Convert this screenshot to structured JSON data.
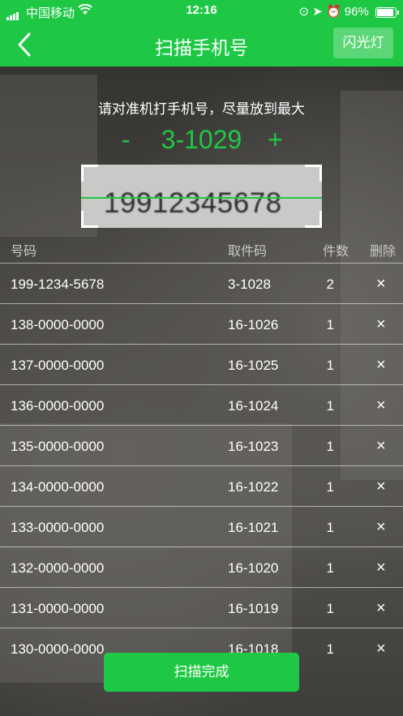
{
  "status_bar": {
    "carrier": "中国移动",
    "time": "12:16",
    "battery": "96%"
  },
  "nav": {
    "title": "扫描手机号",
    "flash_label": "闪光灯"
  },
  "hint": "请对准机打手机号，尽量放到最大",
  "counter": {
    "minus": "-",
    "value": "3-1029",
    "plus": "+"
  },
  "scan_preview_text": "19912345678",
  "table": {
    "headers": {
      "phone": "号码",
      "code": "取件码",
      "count": "件数",
      "delete": "删除"
    },
    "rows": [
      {
        "phone": "199-1234-5678",
        "code": "3-1028",
        "count": "2",
        "delete": "×"
      },
      {
        "phone": "138-0000-0000",
        "code": "16-1026",
        "count": "1",
        "delete": "×"
      },
      {
        "phone": "137-0000-0000",
        "code": "16-1025",
        "count": "1",
        "delete": "×"
      },
      {
        "phone": "136-0000-0000",
        "code": "16-1024",
        "count": "1",
        "delete": "×"
      },
      {
        "phone": "135-0000-0000",
        "code": "16-1023",
        "count": "1",
        "delete": "×"
      },
      {
        "phone": "134-0000-0000",
        "code": "16-1022",
        "count": "1",
        "delete": "×"
      },
      {
        "phone": "133-0000-0000",
        "code": "16-1021",
        "count": "1",
        "delete": "×"
      },
      {
        "phone": "132-0000-0000",
        "code": "16-1020",
        "count": "1",
        "delete": "×"
      },
      {
        "phone": "131-0000-0000",
        "code": "16-1019",
        "count": "1",
        "delete": "×"
      },
      {
        "phone": "130-0000-0000",
        "code": "16-1018",
        "count": "1",
        "delete": "×"
      }
    ]
  },
  "done_label": "扫描完成",
  "colors": {
    "accent": "#1ec845"
  }
}
